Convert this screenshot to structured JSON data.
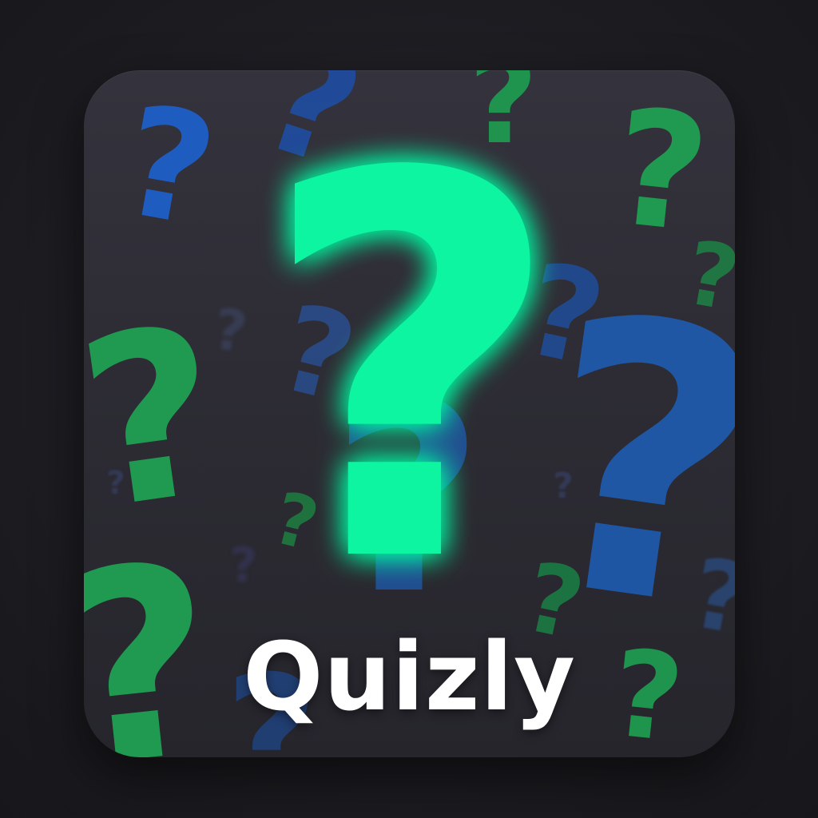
{
  "app": {
    "name": "Quizly"
  },
  "icons": {
    "main": "question-mark-icon",
    "background": "question-mark-icon"
  },
  "colors": {
    "primary_glyph": "#10f5a0",
    "glow": "#1e8fff",
    "green_glyph": "#1f9a50",
    "blue_glyph": "#1d5fb8",
    "tile_background": "#2f2e36",
    "page_background": "#1d1d22",
    "text": "#ffffff"
  }
}
